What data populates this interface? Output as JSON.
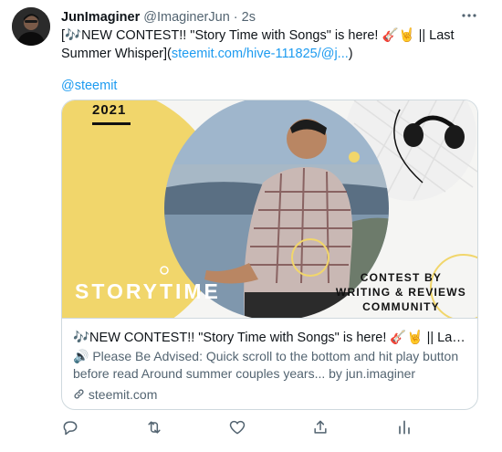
{
  "tweet": {
    "author_name": "JunImaginer",
    "author_handle": "@ImaginerJun",
    "separator": "·",
    "time": "2s",
    "more_icon": "more-dots-icon",
    "text_prefix": "[🎶NEW CONTEST!! \"Story Time with Songs\" is here! 🎸🤘 || Last Summer Whisper](",
    "link_text": "steemit.com/hive-111825/@j...",
    "text_suffix": ")",
    "mention": "@steemit"
  },
  "card": {
    "image": {
      "year": "2021",
      "title": "STORYTIME",
      "contest_line1": "CONTEST BY",
      "contest_line2": "WRITING & REVIEWS",
      "contest_line3": "COMMUNITY"
    },
    "title": "🎶NEW CONTEST!! \"Story Time with Songs\" is here! 🎸🤘 || Last Summ...",
    "description": "🔊 Please Be Advised: Quick scroll to the bottom and hit play button before read   Around summer couples years... by jun.imaginer",
    "domain": "steemit.com",
    "domain_icon": "link-icon"
  },
  "actions": [
    "reply-icon",
    "retweet-icon",
    "like-icon",
    "share-icon",
    "analytics-icon"
  ]
}
